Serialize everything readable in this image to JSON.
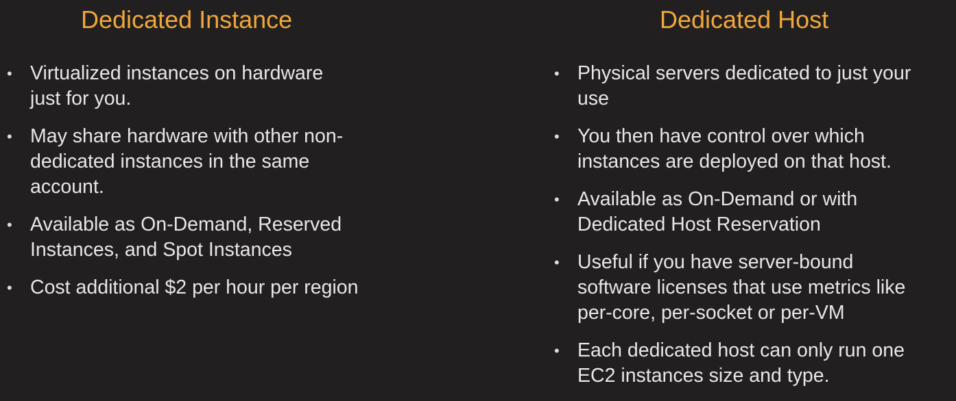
{
  "left": {
    "title": "Dedicated Instance",
    "bullets": [
      [
        "Virtualized instances on hardware",
        "just for you."
      ],
      [
        "May share hardware with other non-",
        "dedicated instances in the same",
        "account."
      ],
      [
        "Available as On-Demand, Reserved",
        "Instances, and Spot Instances"
      ],
      [
        "Cost additional $2 per hour per region"
      ]
    ]
  },
  "right": {
    "title": "Dedicated Host",
    "bullets": [
      [
        "Physical servers dedicated to just your",
        "use"
      ],
      [
        "You then have control over which",
        "instances are deployed on that host."
      ],
      [
        "Available as On-Demand or with",
        "Dedicated Host Reservation"
      ],
      [
        "Useful if you have server-bound",
        "software licenses that use metrics like",
        "per-core, per-socket or per-VM"
      ],
      [
        "Each dedicated host can only run one",
        "EC2 instances size and type."
      ]
    ]
  },
  "bullet_glyph": "•"
}
